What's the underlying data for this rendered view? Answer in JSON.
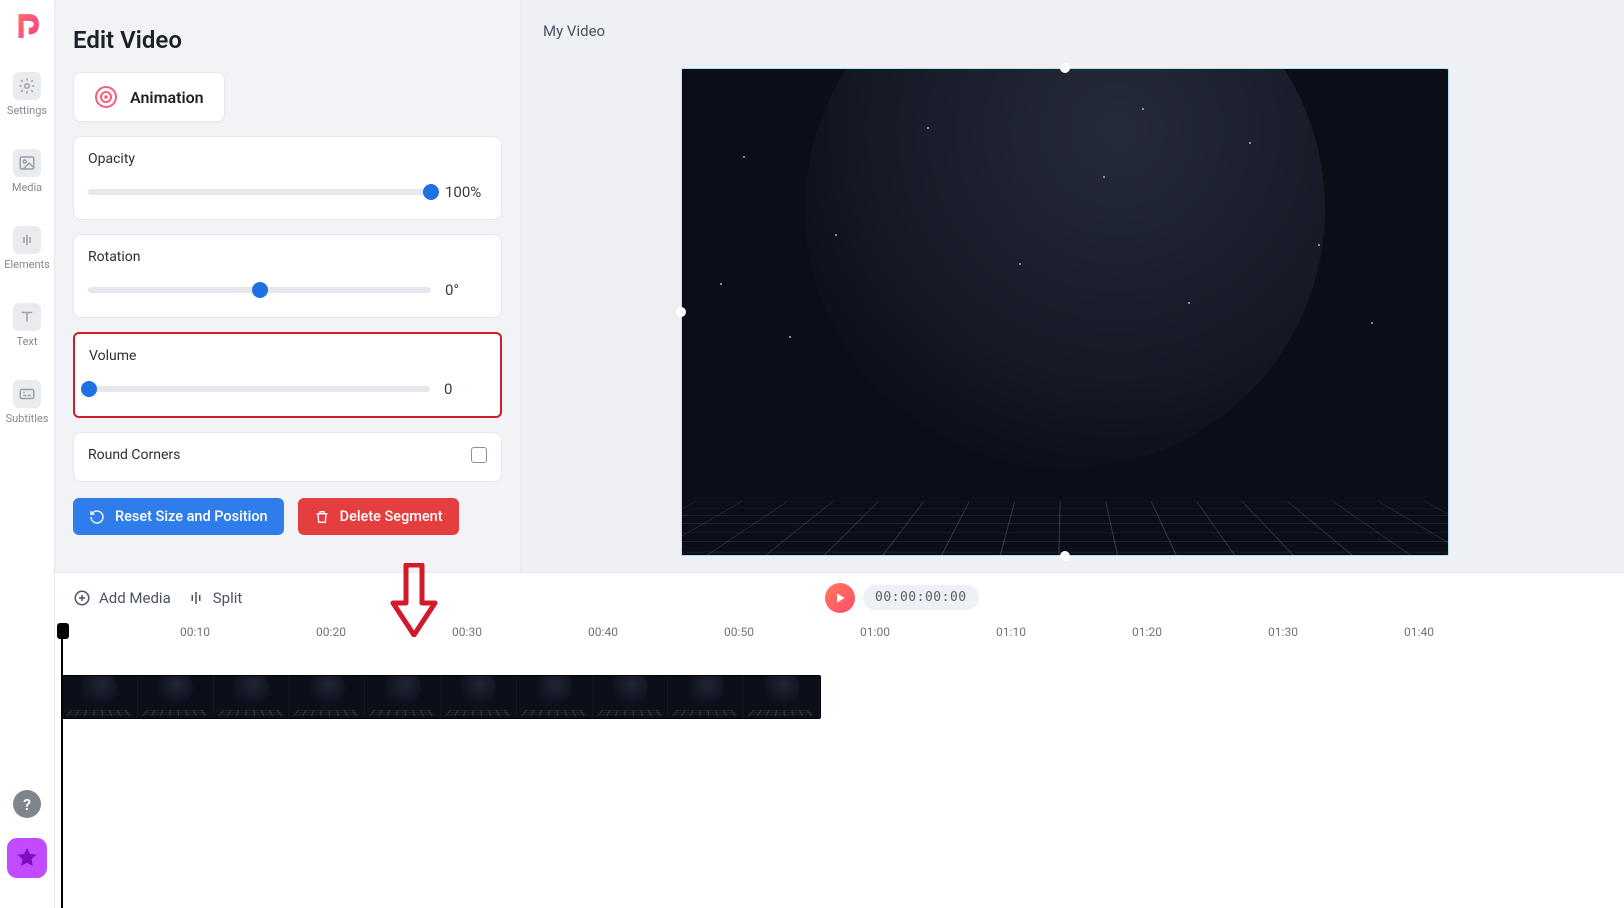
{
  "header": {
    "title": "Edit Video",
    "project": "My Video"
  },
  "rail": {
    "settings": "Settings",
    "media": "Media",
    "elements": "Elements",
    "text": "Text",
    "subtitles": "Subtitles"
  },
  "panel": {
    "animation_label": "Animation",
    "opacity": {
      "label": "Opacity",
      "value": "100%",
      "pct": 100
    },
    "rotation": {
      "label": "Rotation",
      "value": "0°",
      "pct": 50
    },
    "volume": {
      "label": "Volume",
      "value": "0",
      "pct": 0
    },
    "round_corners_label": "Round Corners",
    "reset_label": "Reset Size and Position",
    "delete_label": "Delete Segment"
  },
  "timeline": {
    "add_media": "Add Media",
    "split": "Split",
    "timecode": "00:00:00:00",
    "ticks": [
      "00:10",
      "00:20",
      "00:30",
      "00:40",
      "00:50",
      "01:00",
      "01:10",
      "01:20",
      "01:30",
      "01:40"
    ]
  }
}
